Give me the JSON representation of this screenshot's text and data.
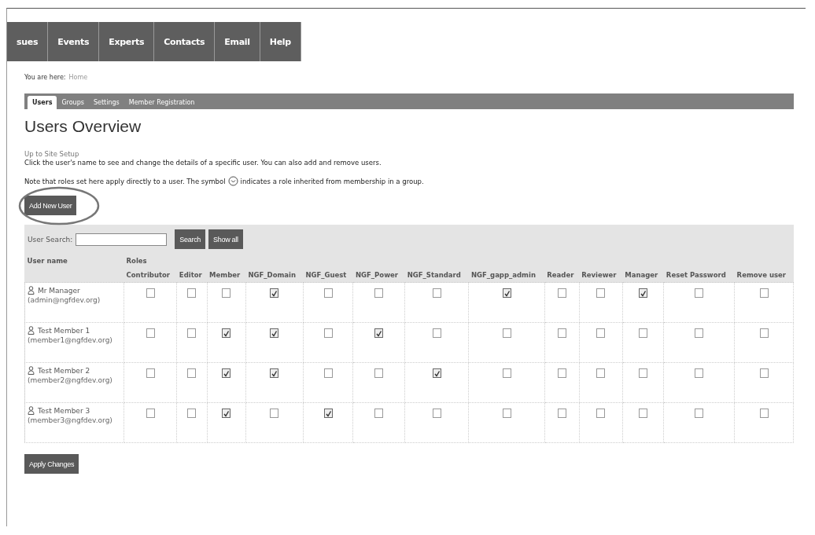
{
  "nav": [
    {
      "label": "sues"
    },
    {
      "label": "Events"
    },
    {
      "label": "Experts"
    },
    {
      "label": "Contacts"
    },
    {
      "label": "Email"
    },
    {
      "label": "Help"
    }
  ],
  "breadcrumb": {
    "label": "You are here:",
    "link": "Home"
  },
  "tabs": [
    {
      "label": "Users",
      "selected": true
    },
    {
      "label": "Groups",
      "selected": false
    },
    {
      "label": "Settings",
      "selected": false
    },
    {
      "label": "Member Registration",
      "selected": false
    }
  ],
  "title": "Users Overview",
  "up_link": "Up to Site Setup",
  "intro": "Click the user's name to see and change the details of a specific user. You can also add and remove users.",
  "note": {
    "before": "Note that roles set here apply directly to a user. The symbol",
    "after": "indicates a role inherited from membership in a group."
  },
  "add_button": "Add New User",
  "search": {
    "label": "User Search:",
    "buttons": [
      "Search",
      "Show all"
    ]
  },
  "table": {
    "name_header": "User name",
    "roles_header": "Roles",
    "columns": [
      "Contributor",
      "Editor",
      "Member",
      "NGF_Domain",
      "NGF_Guest",
      "NGF_Power",
      "NGF_Standard",
      "NGF_gapp_admin",
      "Reader",
      "Reviewer",
      "Manager"
    ],
    "extra_columns": [
      "Reset Password",
      "Remove user"
    ],
    "rows": [
      {
        "name": "Mr Manager",
        "email": "(admin@ngfdev.org)",
        "roles": [
          false,
          false,
          false,
          true,
          false,
          false,
          false,
          true,
          false,
          false,
          true
        ],
        "extra": [
          false,
          false
        ]
      },
      {
        "name": "Test Member 1",
        "email": "(member1@ngfdev.org)",
        "roles": [
          false,
          false,
          true,
          true,
          false,
          true,
          false,
          false,
          false,
          false,
          false
        ],
        "extra": [
          false,
          false
        ]
      },
      {
        "name": "Test Member 2",
        "email": "(member2@ngfdev.org)",
        "roles": [
          false,
          false,
          true,
          true,
          false,
          false,
          true,
          false,
          false,
          false,
          false
        ],
        "extra": [
          false,
          false
        ]
      },
      {
        "name": "Test Member 3",
        "email": "(member3@ngfdev.org)",
        "roles": [
          false,
          false,
          true,
          false,
          true,
          false,
          false,
          false,
          false,
          false,
          false
        ],
        "extra": [
          false,
          false
        ]
      }
    ]
  },
  "apply_button": "Apply Changes"
}
